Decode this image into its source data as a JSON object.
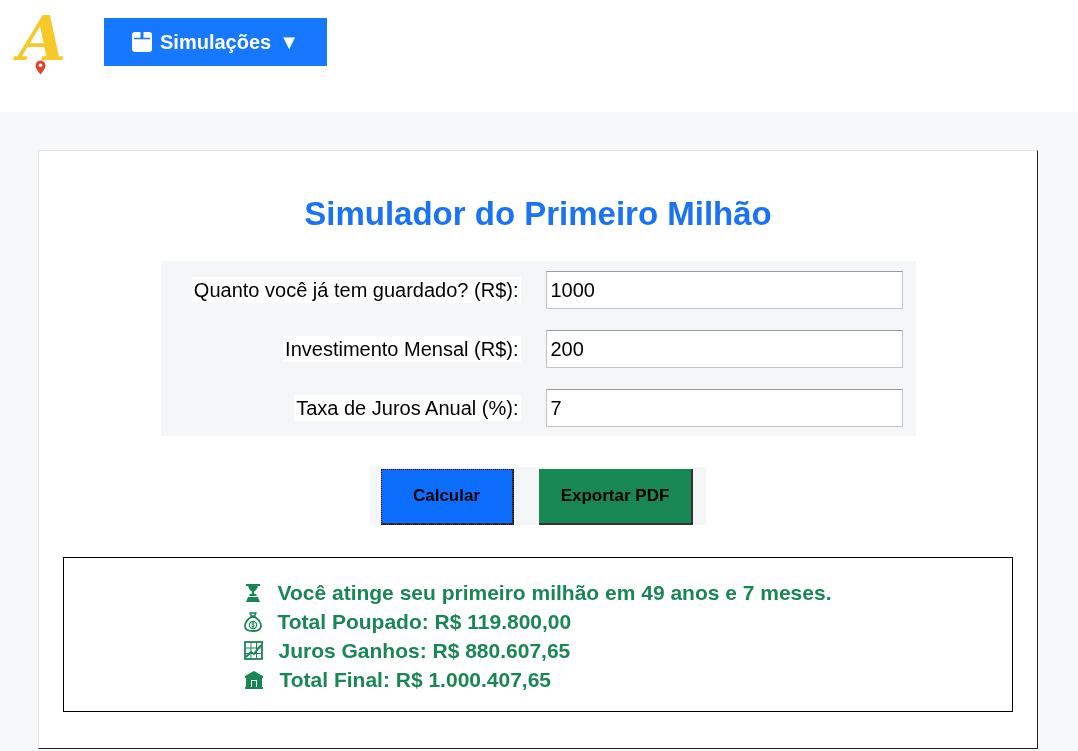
{
  "header": {
    "logo": "A",
    "menu_button": {
      "label": "Simulações",
      "caret": "▼"
    }
  },
  "title": "Simulador do Primeiro Milhão",
  "fields": [
    {
      "label": "Quanto você já tem guardado? (R$):",
      "value": "1000"
    },
    {
      "label": "Investimento Mensal (R$):",
      "value": "200"
    },
    {
      "label": "Taxa de Juros Anual (%):",
      "value": "7"
    }
  ],
  "buttons": [
    {
      "label": "Calcular",
      "kind": "primary",
      "focused": true
    },
    {
      "label": "Exportar PDF",
      "kind": "success",
      "focused": false
    }
  ],
  "results": [
    "Você atinge seu primeiro milhão em 49 anos e 7 meses.",
    "Total Poupado: R$ 119.800,00",
    "Juros Ganhos: R$ 880.607,65",
    "Total Final: R$ 1.000.407,65"
  ]
}
